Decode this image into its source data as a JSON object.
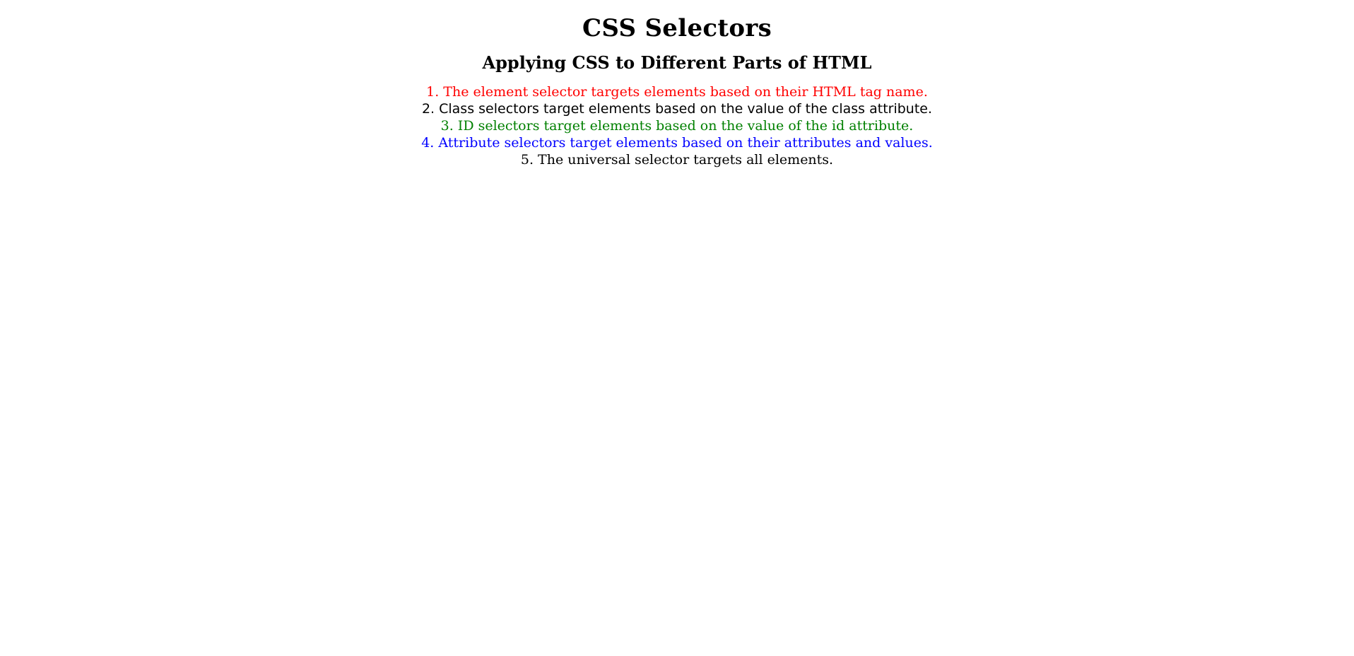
{
  "page": {
    "title": "CSS Selectors",
    "subtitle": "Applying CSS to Different Parts of HTML"
  },
  "lines": [
    {
      "text": "1. The element selector targets elements based on their HTML tag name.",
      "color": "#ff0000"
    },
    {
      "text": "2. Class selectors target elements based on the value of the class attribute.",
      "color": "#000000"
    },
    {
      "text": "3. ID selectors target elements based on the value of the id attribute.",
      "color": "#008000"
    },
    {
      "text": "4. Attribute selectors target elements based on their attributes and values.",
      "color": "#0000ff"
    },
    {
      "text": "5. The universal selector targets all elements.",
      "color": "#000000"
    }
  ]
}
